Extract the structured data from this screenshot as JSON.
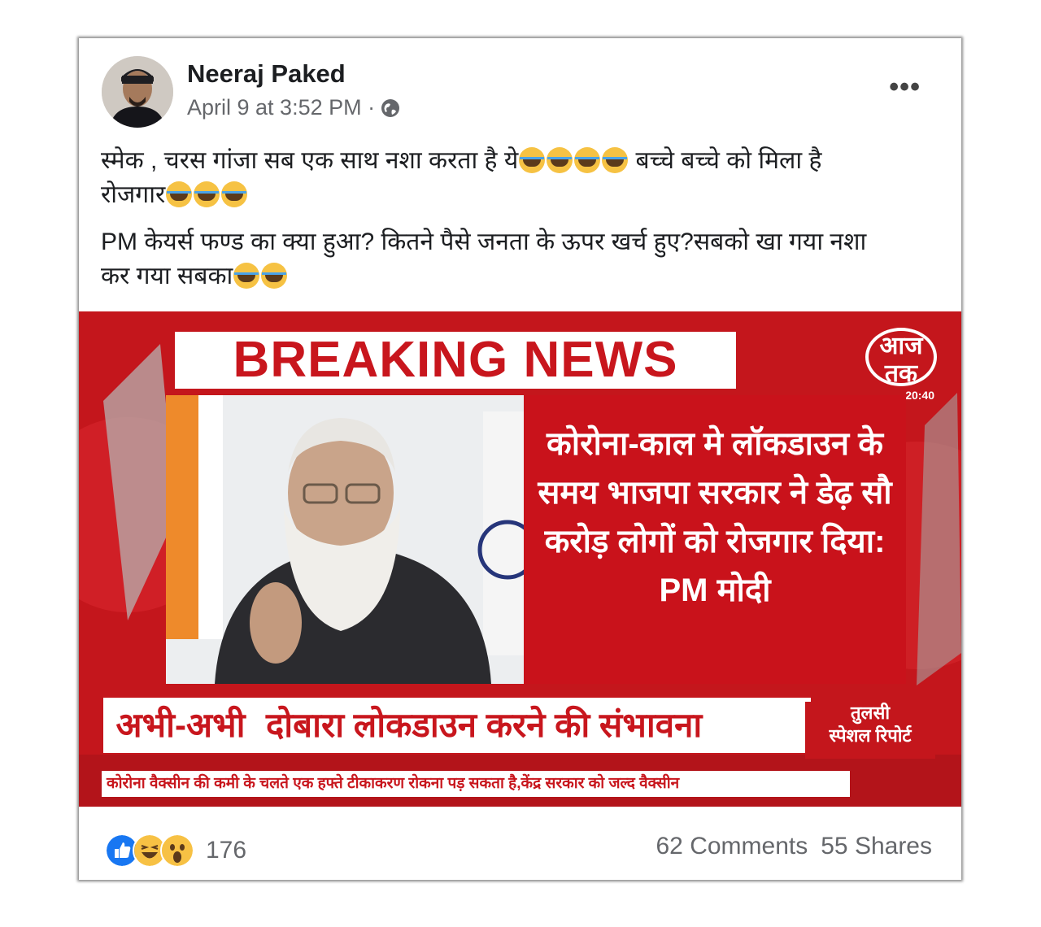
{
  "post": {
    "author": "Neeraj Paked",
    "time": "April 9 at 3:52 PM ·",
    "privacy_icon": "globe-icon",
    "more_label": "•••",
    "paragraph1_a": "स्मेक , चरस गांजा सब एक साथ नशा करता है ये",
    "paragraph1_b": " बच्चे बच्चे को मिला है",
    "paragraph1_c": "रोजगार",
    "paragraph2_a": "PM केयर्स फण्ड का क्या हुआ? कितने पैसे जनता के ऊपर खर्च हुए?सबको खा गया नशा",
    "paragraph2_b": "कर गया सबका"
  },
  "news_image": {
    "breaking": "BREAKING NEWS",
    "logo_line1": "आज",
    "logo_line2": "तक",
    "clock": "20:40",
    "headline": "कोरोना-काल मे लॉकडाउन के समय भाजपा सरकार ने डेढ़ सौ करोड़ लोगों को रोजगार दिया: PM मोदी",
    "ticker_tag": "अभी-अभी",
    "ticker_text": "दोबारा लोकडाउन करने की संभावना",
    "special_brand": "तुलसी",
    "special_label": "स्पेशल रिपोर्ट",
    "crawl": "कोरोना वैक्सीन की कमी के चलते एक हफ्ते टीकाकरण रोकना पड़ सकता है,केंद्र सरकार को जल्द वैक्सीन"
  },
  "footer": {
    "reaction_icons": [
      "like-icon",
      "haha-icon",
      "wow-icon"
    ],
    "reaction_count": "176",
    "comments": "62 Comments",
    "shares": "55 Shares"
  },
  "colors": {
    "news_red": "#c4161c",
    "like_blue": "#1877f2",
    "text_gray": "#65676b"
  }
}
